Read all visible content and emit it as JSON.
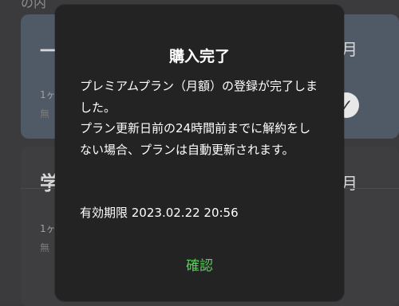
{
  "background": {
    "top_text": "の内",
    "selected_plan": {
      "title": "一",
      "right_label": "月",
      "line1": "1ヶ",
      "line2": "無"
    },
    "other_plan": {
      "title": "学",
      "right_label": "月",
      "line1": "1ヶ",
      "line2": "無"
    }
  },
  "dialog": {
    "title": "購入完了",
    "message_lines": [
      "プレミアムプラン（月額）の登録が完了しました。",
      "プラン更新日前の24時間前までに解約をしない場合、プランは自動更新されます。"
    ],
    "expiry": "有効期限 2023.02.22 20:56",
    "confirm_label": "確認"
  },
  "colors": {
    "dialog_bg": "#232323",
    "confirm_text": "#5ccc5f",
    "selected_card": "#505a66"
  }
}
